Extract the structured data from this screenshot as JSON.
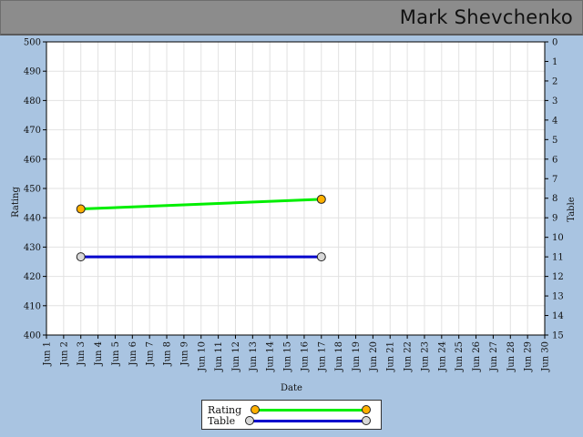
{
  "header": {
    "title": "Mark Shevchenko"
  },
  "chart_data": {
    "type": "line",
    "xlabel": "Date",
    "ylabel": "Rating",
    "y2label": "Table",
    "categories": [
      "Jun 1",
      "Jun 2",
      "Jun 3",
      "Jun 4",
      "Jun 5",
      "Jun 6",
      "Jun 7",
      "Jun 8",
      "Jun 9",
      "Jun 10",
      "Jun 11",
      "Jun 12",
      "Jun 13",
      "Jun 14",
      "Jun 15",
      "Jun 16",
      "Jun 17",
      "Jun 18",
      "Jun 19",
      "Jun 20",
      "Jun 21",
      "Jun 22",
      "Jun 23",
      "Jun 24",
      "Jun 25",
      "Jun 26",
      "Jun 27",
      "Jun 28",
      "Jun 29",
      "Jun 30"
    ],
    "ylim": [
      400,
      500
    ],
    "y2lim": [
      0,
      15
    ],
    "y2_inverted": true,
    "grid": true,
    "legend_position": "bottom",
    "series": [
      {
        "name": "Rating",
        "axis": "left",
        "color": "#00ee00",
        "marker_color": "#ffb000",
        "points": [
          {
            "x": "Jun 3",
            "y": 443
          },
          {
            "x": "Jun 17",
            "y": 446.3
          }
        ]
      },
      {
        "name": "Table",
        "axis": "right",
        "color": "#0000cc",
        "marker_color": "#d8d8d8",
        "points": [
          {
            "x": "Jun 3",
            "y": 11
          },
          {
            "x": "Jun 17",
            "y": 11
          }
        ]
      }
    ]
  }
}
